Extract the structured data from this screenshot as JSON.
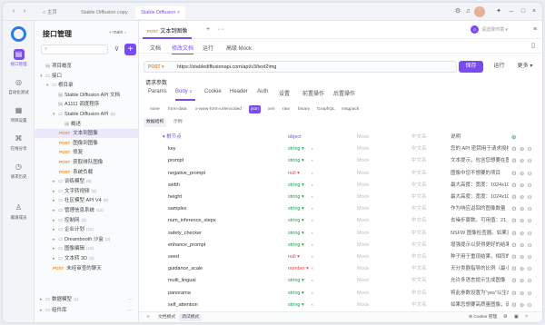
{
  "window": {
    "tabs": [
      "主页",
      "Stable Diffusion copy",
      "Stable Diffusion"
    ],
    "active_tab": 2
  },
  "rail": {
    "items": [
      {
        "label": "接口管理",
        "icon": "api-icon"
      },
      {
        "label": "自动化测试",
        "icon": "test-icon"
      },
      {
        "label": "项目设置",
        "icon": "settings-icon"
      },
      {
        "label": "在线分享",
        "icon": "share-icon"
      },
      {
        "label": "请求历史",
        "icon": "history-icon"
      },
      {
        "label": "邀请成员",
        "icon": "invite-icon"
      }
    ]
  },
  "sidebar": {
    "title": "接口管理",
    "branch": "main",
    "search_placeholder": "",
    "tree": [
      {
        "label": "项目概览",
        "indent": 0,
        "kind": "icon"
      },
      {
        "label": "接口",
        "indent": 0,
        "kind": "folder",
        "twist": "▾"
      },
      {
        "label": "根目录",
        "indent": 1,
        "kind": "folder",
        "twist": "▾"
      },
      {
        "label": "Stable Diffusion API 文档",
        "indent": 2,
        "kind": "doc"
      },
      {
        "label": "A1111 调度程序",
        "indent": 2,
        "kind": "doc"
      },
      {
        "label": "Stable Diffusion API",
        "indent": 2,
        "kind": "folder",
        "twist": "▾",
        "count": "(6)"
      },
      {
        "label": "概述",
        "indent": 3,
        "kind": "doc"
      },
      {
        "label": "文本到图像",
        "indent": 3,
        "method": "POST",
        "selected": true
      },
      {
        "label": "图像到图像",
        "indent": 3,
        "method": "POST"
      },
      {
        "label": "修复",
        "indent": 3,
        "method": "POST"
      },
      {
        "label": "获取排队图像",
        "indent": 3,
        "method": "POST"
      },
      {
        "label": "系统负载",
        "indent": 3,
        "method": "POST"
      },
      {
        "label": "训练模型",
        "indent": 2,
        "kind": "folder",
        "twist": "▸",
        "count": "(9)"
      },
      {
        "label": "文字转视频",
        "indent": 2,
        "kind": "folder",
        "twist": "▸",
        "count": "(3)"
      },
      {
        "label": "社区模型 API V4",
        "indent": 2,
        "kind": "folder",
        "twist": "▸",
        "count": "(8)"
      },
      {
        "label": "管理信息系统",
        "indent": 2,
        "kind": "folder",
        "twist": "▸",
        "count": "(12)"
      },
      {
        "label": "控制网",
        "indent": 2,
        "kind": "folder",
        "twist": "▸",
        "count": "(3)"
      },
      {
        "label": "企业计划",
        "indent": 2,
        "kind": "folder",
        "twist": "▸",
        "count": "(22)"
      },
      {
        "label": "Dreambooth 沙盒",
        "indent": 2,
        "kind": "folder",
        "twist": "▸",
        "count": "(3)"
      },
      {
        "label": "图像编辑",
        "indent": 2,
        "kind": "folder",
        "twist": "▸",
        "count": "(10)"
      },
      {
        "label": "文本转 3D",
        "indent": 2,
        "kind": "folder",
        "twist": "▸",
        "count": "(3)"
      },
      {
        "label": "未经审查的聊天",
        "indent": 2,
        "method": "POST"
      }
    ],
    "footer": [
      {
        "label": "数据模型",
        "count": "(1)"
      },
      {
        "label": "组件库",
        "count": ""
      }
    ]
  },
  "main": {
    "api_tab": {
      "method": "POST",
      "label": "文本到图像"
    },
    "env": "请选择环境",
    "subtabs": [
      "文档",
      "修改文档",
      "运行",
      "高级 Mock"
    ],
    "active_subtab": 1,
    "method": "POST",
    "url": "https://stablediffusionapi.com/api/v3/text2img",
    "save": "保存",
    "run": "运行",
    "more": "更多",
    "req_title": "请求参数",
    "req_tabs": [
      "Params",
      "Body",
      "Cookie",
      "Header",
      "Auth",
      "设置",
      "前置操作",
      "后置操作"
    ],
    "body_badge": "1",
    "active_req_tab": 1,
    "body_types": [
      "none",
      "form-data",
      "x-www-form-urlencoded",
      "json",
      "xml",
      "raw",
      "binary",
      "GraphQL",
      "msgpack"
    ],
    "active_body_type": 3,
    "schema_tabs": [
      "数据结构",
      "示例"
    ],
    "active_schema_tab": 0,
    "root": {
      "name": "根节点",
      "type": "object",
      "mock": "Mock",
      "cn": "中文名",
      "desc": "说明"
    },
    "fields": [
      {
        "name": "key",
        "type": "string",
        "mark": "*",
        "mock": "Mock",
        "cn": "中文名",
        "desc": "您的 API 密钥用于请求授权"
      },
      {
        "name": "prompt",
        "type": "string",
        "mark": "*",
        "mock": "Mock",
        "cn": "中文名",
        "desc": "文本提示，包含您想要在图像中看到的内容"
      },
      {
        "name": "negative_prompt",
        "type": "null",
        "mark": "*",
        "mock": "Mock",
        "cn": "中文名",
        "desc": "图像中您不想要的项目"
      },
      {
        "name": "width",
        "type": "string",
        "mark": "*",
        "mock": "Mock",
        "cn": "中文名",
        "desc": "最大高度：宽度：1024x1024"
      },
      {
        "name": "height",
        "type": "string",
        "mark": "*",
        "mock": "Mock",
        "cn": "中文名",
        "desc": "最大高度：宽度：1024x1024"
      },
      {
        "name": "samples",
        "type": "string",
        "mark": "*",
        "mock": "Mock",
        "cn": "中文名",
        "desc": "作为响应返回的图像数量"
      },
      {
        "name": "num_inference_steps",
        "type": "string",
        "mark": "*",
        "mock": "Mock",
        "cn": "中文名",
        "desc": "去噪步骤数。可用值：21, 31"
      },
      {
        "name": "safety_checker",
        "type": "string",
        "mark": "*",
        "mock": "Mock",
        "cn": "中文名",
        "desc": "NSFW 图像检查器。如果发现"
      },
      {
        "name": "enhance_prompt",
        "type": "string",
        "mark": "*",
        "mock": "Mock",
        "cn": "中文名",
        "desc": "增强提示以获得更好的结果"
      },
      {
        "name": "seed",
        "type": "null",
        "mark": "*",
        "mock": "Mock",
        "cn": "中文名",
        "desc": "种子用于重现结果，相同的"
      },
      {
        "name": "guidance_scale",
        "type": "number",
        "mark": "*",
        "mock": "Mock",
        "cn": "中文名",
        "desc": "无分类器指导的比例（最小"
      },
      {
        "name": "multi_lingual",
        "type": "string",
        "mark": "*",
        "mock": "Mock",
        "cn": "中文名",
        "desc": "允许多语言提示生成图像"
      },
      {
        "name": "panorama",
        "type": "string",
        "mark": "*",
        "mock": "Mock",
        "cn": "中文名",
        "desc": "将此参数设置为\"yes\"以生成全景图"
      },
      {
        "name": "self_attention",
        "type": "string",
        "mark": "*",
        "mock": "Mock",
        "cn": "中文名",
        "desc": "如果您想要高质量图像，请"
      }
    ],
    "statusbar": [
      "文档模式",
      "调试模式"
    ],
    "active_status": 1,
    "cookie_mgr": "Cookie 管理"
  }
}
